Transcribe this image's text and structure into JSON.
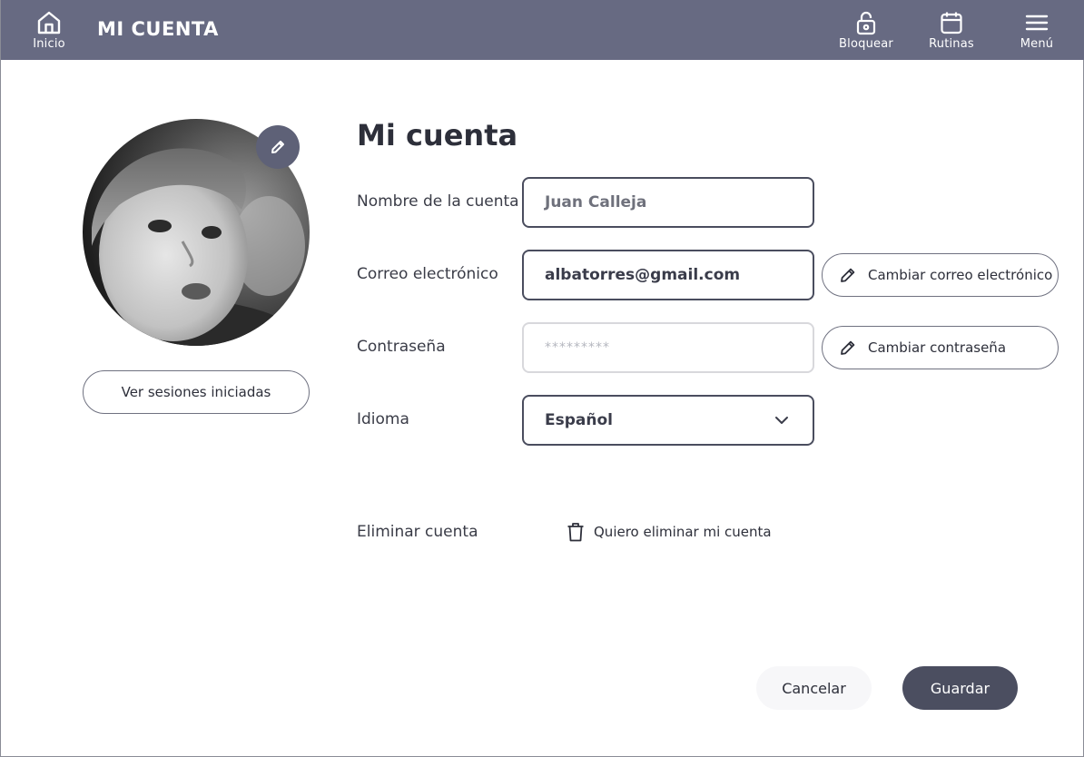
{
  "topbar": {
    "title": "MI CUENTA",
    "home_label": "Inicio",
    "lock_label": "Bloquear",
    "routines_label": "Rutinas",
    "menu_label": "Menú",
    "bg_color": "#676a82"
  },
  "profile": {
    "sessions_button": "Ver sesiones iniciadas"
  },
  "account": {
    "title": "Mi cuenta",
    "name_label": "Nombre de la cuenta",
    "name_value": "Juan Calleja",
    "email_label": "Correo electrónico",
    "email_value": "albatorres@gmail.com",
    "change_email_button": "Cambiar correo electrónico",
    "password_label": "Contraseña",
    "password_value": "*********",
    "change_password_button": "Cambiar contraseña",
    "language_label": "Idioma",
    "language_value": "Español",
    "delete_label": "Eliminar cuenta",
    "delete_link": "Quiero eliminar mi cuenta"
  },
  "actions": {
    "cancel": "Cancelar",
    "save": "Guardar"
  },
  "icons": [
    "home-icon",
    "lock-icon",
    "calendar-icon",
    "menu-icon",
    "pencil-icon",
    "chevron-down-icon",
    "trash-icon"
  ]
}
